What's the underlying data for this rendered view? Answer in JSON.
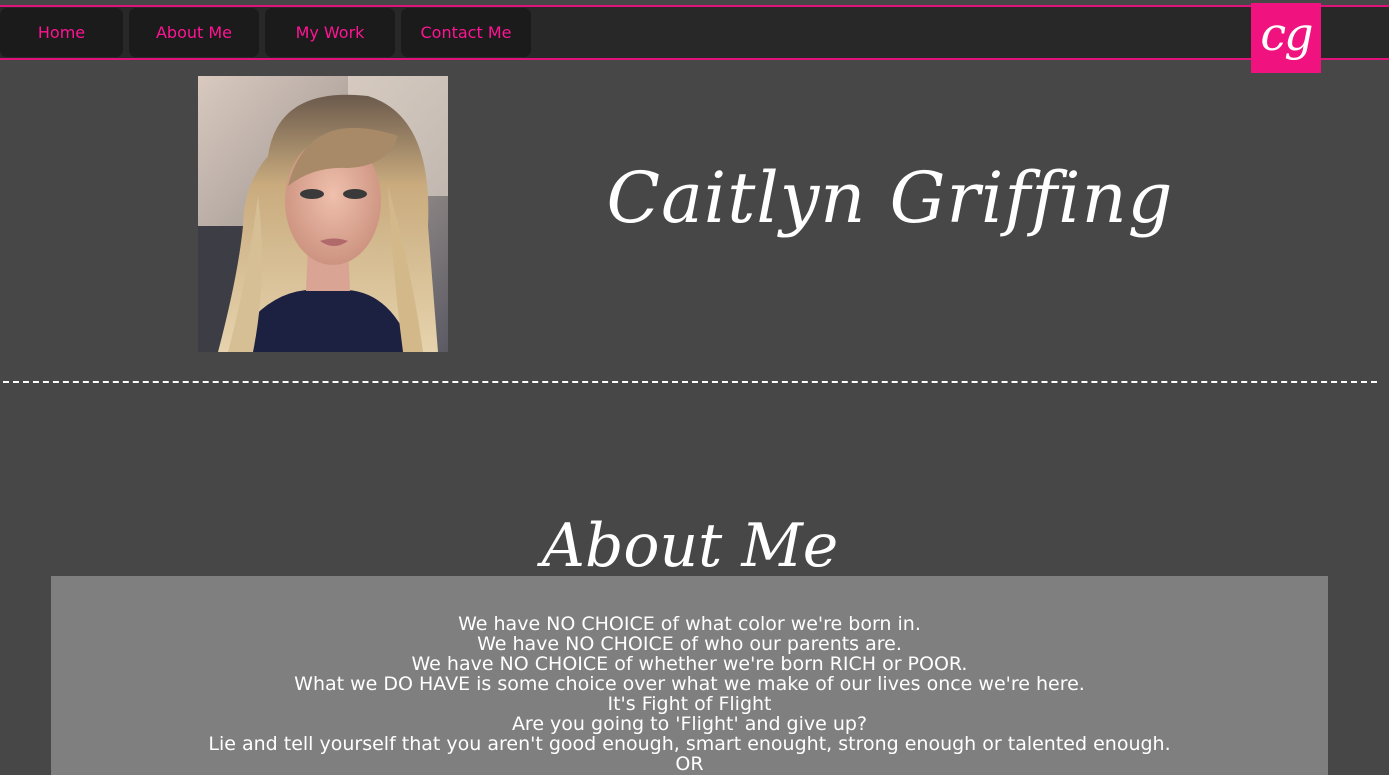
{
  "nav": {
    "items": [
      {
        "label": "Home"
      },
      {
        "label": "About Me"
      },
      {
        "label": "My Work"
      },
      {
        "label": "Contact Me"
      }
    ],
    "accent_color": "#ff1493"
  },
  "logo": {
    "text": "cg",
    "color": "#f0137f"
  },
  "profile": {
    "name": "Caitlyn Griffing"
  },
  "about": {
    "heading": "About Me",
    "lines": [
      "We have NO CHOICE of what color we're born in.",
      "We have NO CHOICE of who our parents are.",
      "We have NO CHOICE of whether we're born RICH or POOR.",
      "What we DO HAVE is some choice over what we make of our lives once we're here.",
      "It's Fight of Flight",
      "Are you going to 'Flight' and give up?",
      "Lie and tell yourself that you aren't good enough, smart enought, strong enough or talented enough.",
      "OR"
    ]
  }
}
